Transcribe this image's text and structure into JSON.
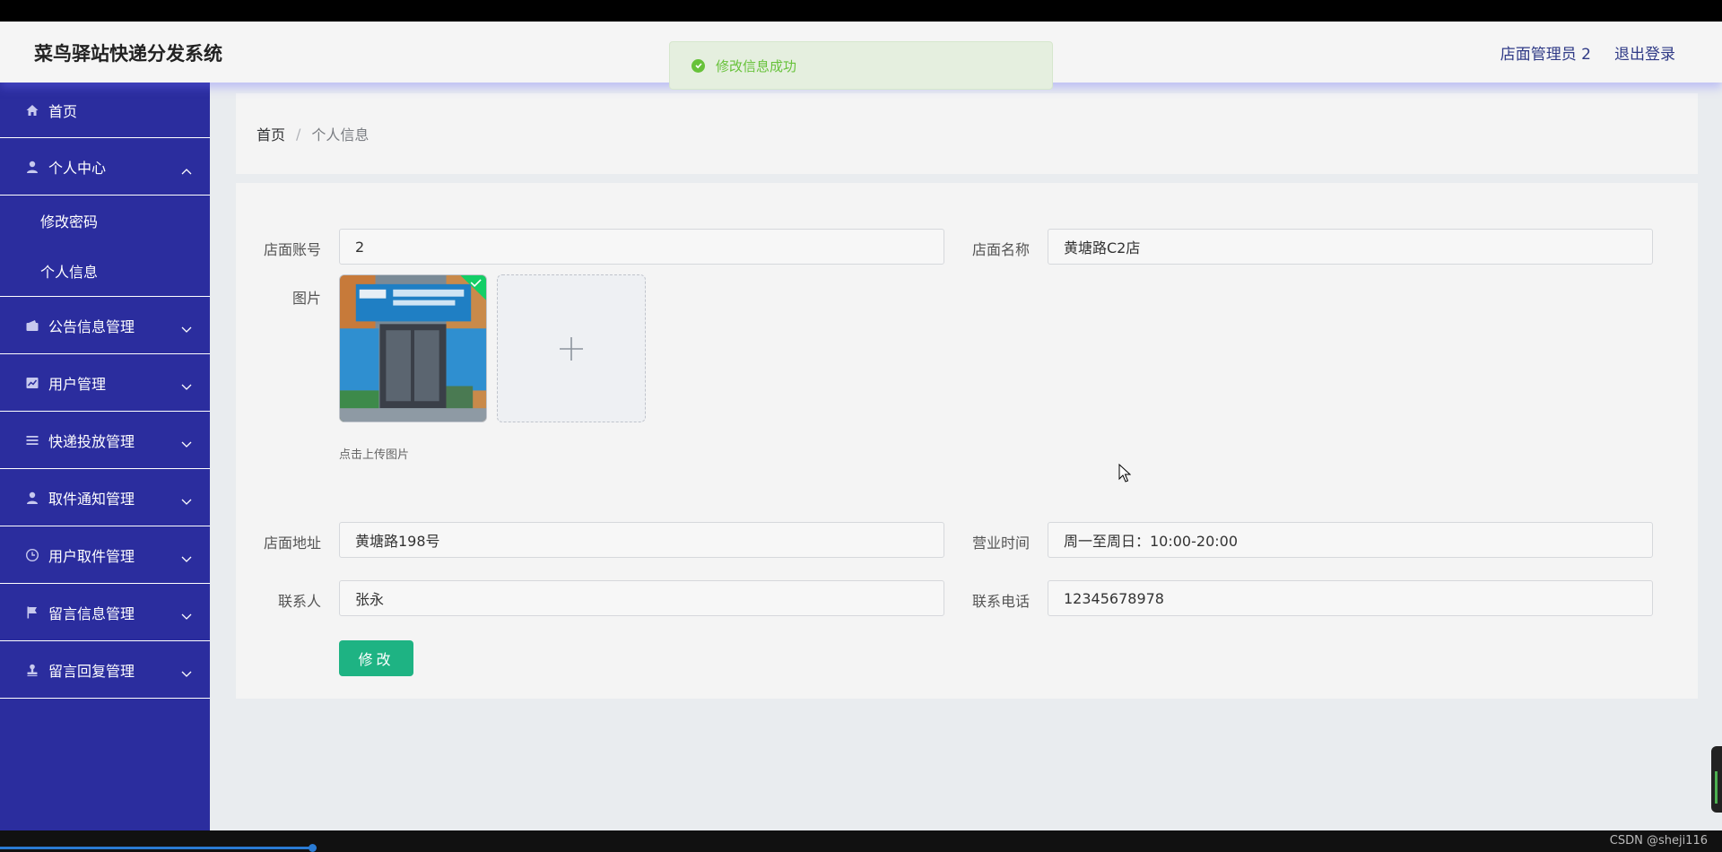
{
  "header": {
    "title": "菜鸟驿站快递分发系统",
    "user_label": "店面管理员 2",
    "logout_label": "退出登录"
  },
  "toast": {
    "message": "修改信息成功",
    "color": "#67c23a"
  },
  "sidebar": {
    "bg_color": "#2b2d9e",
    "items": [
      {
        "label": "首页",
        "icon": "home-icon"
      },
      {
        "label": "个人中心",
        "icon": "user-icon",
        "expanded": true,
        "children": [
          {
            "label": "修改密码"
          },
          {
            "label": "个人信息"
          }
        ]
      },
      {
        "label": "公告信息管理",
        "icon": "wallet-icon"
      },
      {
        "label": "用户管理",
        "icon": "chart-icon"
      },
      {
        "label": "快递投放管理",
        "icon": "list-icon"
      },
      {
        "label": "取件通知管理",
        "icon": "user-icon"
      },
      {
        "label": "用户取件管理",
        "icon": "clock-icon"
      },
      {
        "label": "留言信息管理",
        "icon": "flag-icon"
      },
      {
        "label": "留言回复管理",
        "icon": "stamp-icon"
      }
    ]
  },
  "breadcrumb": {
    "home": "首页",
    "separator": "/",
    "current": "个人信息"
  },
  "form": {
    "account": {
      "label": "店面账号",
      "value": "2"
    },
    "name": {
      "label": "店面名称",
      "value": "黄塘路C2店"
    },
    "image": {
      "label": "图片",
      "tip": "点击上传图片"
    },
    "address": {
      "label": "店面地址",
      "value": "黄塘路198号"
    },
    "hours": {
      "label": "营业时间",
      "value": "周一至周日：10:00-20:00"
    },
    "contact": {
      "label": "联系人",
      "value": "张永"
    },
    "phone": {
      "label": "联系电话",
      "value": "12345678978"
    },
    "submit_label": "修改",
    "submit_color": "#1eb383"
  },
  "footer": {
    "watermark": "CSDN @sheji116"
  }
}
